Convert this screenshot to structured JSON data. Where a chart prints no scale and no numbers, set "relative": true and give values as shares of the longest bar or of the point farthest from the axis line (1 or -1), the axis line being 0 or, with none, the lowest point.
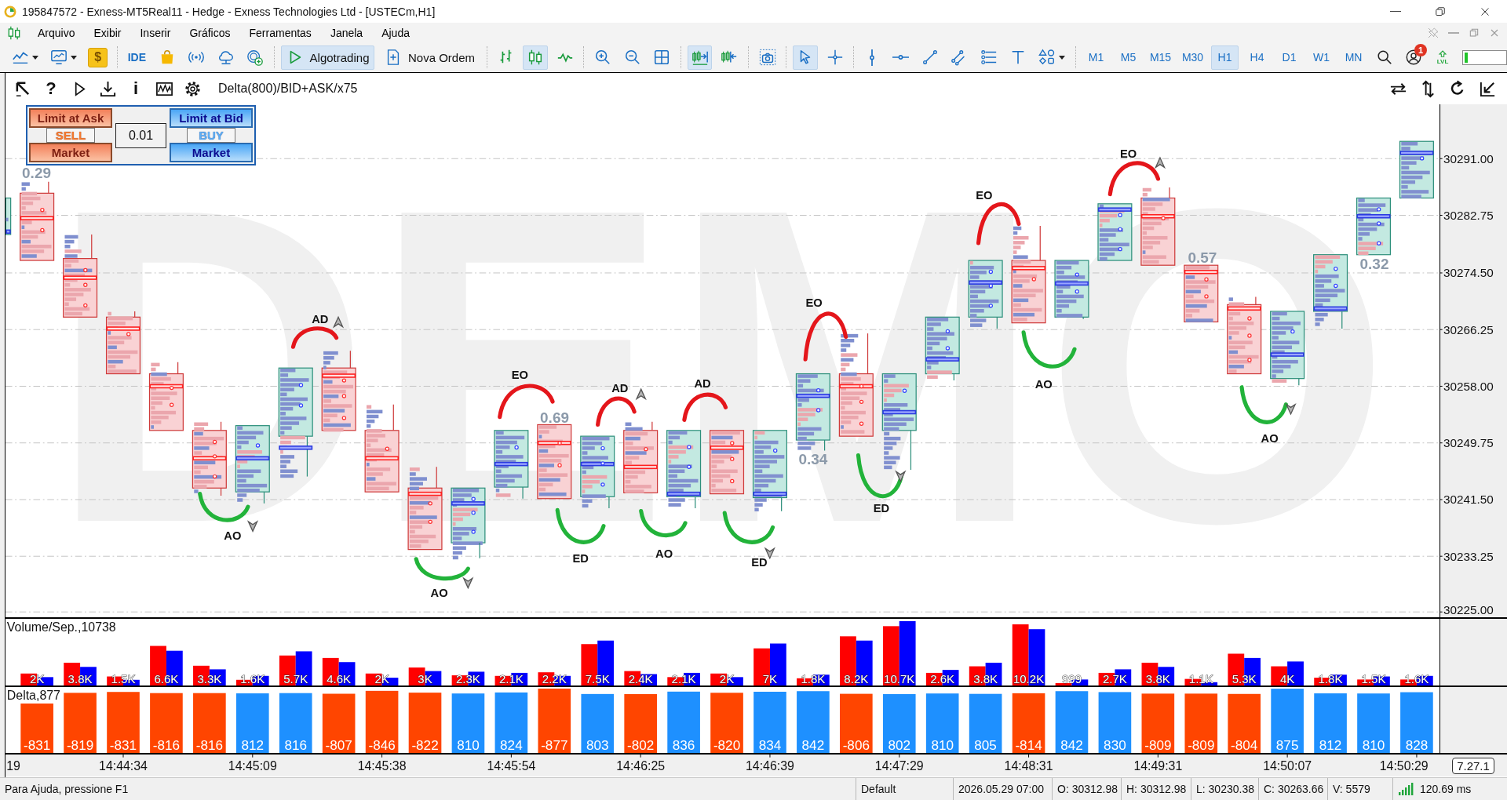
{
  "window": {
    "title": "195847572 - Exness-MT5Real11 - Hedge - Exness Technologies Ltd - [USTECm,H1]"
  },
  "menu": [
    "Arquivo",
    "Exibir",
    "Inserir",
    "Gráficos",
    "Ferramentas",
    "Janela",
    "Ajuda"
  ],
  "toolbar": {
    "market_glyph": "$",
    "ide": "IDE",
    "algotrading": {
      "label": "Algotrading",
      "on": true
    },
    "new_order": "Nova Ordem",
    "chart_types": [
      {
        "kind": "bars",
        "selected": false
      },
      {
        "kind": "candles",
        "selected": true
      },
      {
        "kind": "line",
        "selected": false
      }
    ],
    "scroll_tools": [
      {
        "kind": "autoscroll",
        "selected": true
      },
      {
        "kind": "shift",
        "selected": false
      }
    ],
    "pointer_tools": [
      {
        "kind": "cursor",
        "selected": true
      },
      {
        "kind": "crosshair",
        "selected": false
      }
    ],
    "timeframes": [
      {
        "label": "M1",
        "selected": false
      },
      {
        "label": "M5",
        "selected": false
      },
      {
        "label": "M15",
        "selected": false
      },
      {
        "label": "M30",
        "selected": false
      },
      {
        "label": "H1",
        "selected": true
      },
      {
        "label": "H4",
        "selected": false
      },
      {
        "label": "D1",
        "selected": false
      },
      {
        "label": "W1",
        "selected": false
      },
      {
        "label": "MN",
        "selected": false
      }
    ],
    "notifications": "1",
    "level_badge": "LVL",
    "quota": {
      "level": 0.07
    }
  },
  "chart": {
    "toolbar": {
      "help": "?",
      "info": "i",
      "indicator": "Delta(800)/BID+ASK/x75"
    },
    "order_panel": {
      "sell": {
        "limit": "Limit at Ask",
        "side": "SELL",
        "market": "Market"
      },
      "lot": "0.01",
      "buy": {
        "limit": "Limit at Bid",
        "side": "BUY",
        "market": "Market"
      }
    },
    "watermark": "DEMO",
    "price_axis": [
      "30291.00",
      "30282.75",
      "30274.50",
      "30266.25",
      "30258.00",
      "30249.75",
      "30241.50",
      "30233.25",
      "30225.00"
    ],
    "candles": [
      {
        "kind": "bull"
      },
      {
        "kind": "bear"
      },
      {
        "kind": "bear"
      },
      {
        "kind": "bear"
      },
      {
        "kind": "bear"
      },
      {
        "kind": "bear"
      },
      {
        "kind": "bull"
      },
      {
        "kind": "bull"
      },
      {
        "kind": "bear"
      },
      {
        "kind": "bear"
      },
      {
        "kind": "bear"
      },
      {
        "kind": "bull"
      },
      {
        "kind": "bull"
      },
      {
        "kind": "bear"
      },
      {
        "kind": "bull"
      },
      {
        "kind": "bear"
      },
      {
        "kind": "bull"
      },
      {
        "kind": "bear"
      },
      {
        "kind": "bull"
      },
      {
        "kind": "bull"
      },
      {
        "kind": "bear"
      },
      {
        "kind": "bull"
      },
      {
        "kind": "bull"
      },
      {
        "kind": "bull"
      },
      {
        "kind": "bear"
      },
      {
        "kind": "bull"
      },
      {
        "kind": "bull"
      },
      {
        "kind": "bear"
      },
      {
        "kind": "bear"
      },
      {
        "kind": "bear"
      },
      {
        "kind": "bull"
      },
      {
        "kind": "bull"
      },
      {
        "kind": "bull"
      },
      {
        "kind": "bull"
      }
    ],
    "ratios": [
      "0.29",
      "0.69",
      "0.34",
      "0.57",
      "0.32"
    ],
    "markers": [
      {
        "kind": "bottom",
        "label": "AO",
        "arrow": true
      },
      {
        "kind": "top",
        "label": "AD",
        "arrow": true
      },
      {
        "kind": "bottom",
        "label": "AO",
        "arrow": true
      },
      {
        "kind": "top",
        "label": "EO",
        "arrow": false
      },
      {
        "kind": "bottom",
        "label": "ED",
        "arrow": false
      },
      {
        "kind": "top",
        "label": "AD",
        "arrow": true
      },
      {
        "kind": "bottom",
        "label": "AO",
        "arrow": false
      },
      {
        "kind": "top",
        "label": "AD",
        "arrow": false
      },
      {
        "kind": "bottom",
        "label": "ED",
        "arrow": true
      },
      {
        "kind": "top",
        "label": "EO",
        "arrow": false
      },
      {
        "kind": "bottom",
        "label": "ED",
        "arrow": true
      },
      {
        "kind": "top",
        "label": "EO",
        "arrow": false
      },
      {
        "kind": "bottom",
        "label": "AO",
        "arrow": false
      },
      {
        "kind": "top",
        "label": "EO",
        "arrow": true
      },
      {
        "kind": "bottom",
        "label": "AO",
        "arrow": true
      }
    ],
    "volume": {
      "title": "Volume/Sep.,10738",
      "bar_labels": [
        "2K",
        "3.8K",
        "1.5K",
        "6.6K",
        "3.3K",
        "1.6K",
        "5.7K",
        "4.6K",
        "2K",
        "3K",
        "2.3K",
        "2.1K",
        "2.2K",
        "7.5K",
        "2.4K",
        "2.1K",
        "2K",
        "7K",
        "1.8K",
        "8.2K",
        "10.7K",
        "2.6K",
        "3.8K",
        "10.2K",
        "999",
        "2.7K",
        "3.8K",
        "1.1K",
        "5.3K",
        "4K",
        "1.8K",
        "1.5K",
        "1.6K"
      ],
      "chart_data": {
        "type": "bar",
        "relative": true,
        "categories": [
          null,
          null,
          null,
          null,
          null,
          null,
          null,
          null,
          null,
          null,
          null,
          null,
          null,
          null,
          null,
          null,
          null,
          null,
          null,
          null,
          null,
          null,
          null,
          null,
          null,
          null,
          null,
          null,
          null,
          null,
          null,
          null,
          null
        ],
        "series": [
          {
            "color": "#ff0000",
            "values": [
              0.186,
              0.354,
              0.14,
              0.615,
              0.307,
              0.088,
              0.466,
              0.428,
              0.186,
              0.279,
              0.158,
              0.149,
              0.205,
              0.643,
              0.224,
              0.13,
              0.186,
              0.577,
              0.112,
              0.764,
              0.922,
              0.196,
              0.298,
              0.95,
              0.037,
              0.196,
              0.354,
              0.102,
              0.494,
              0.298,
              0.121,
              0.093,
              0.093
            ]
          },
          {
            "color": "#0000ff",
            "values": [
              0.13,
              0.289,
              0.088,
              0.54,
              0.251,
              0.149,
              0.531,
              0.363,
              0.121,
              0.224,
              0.214,
              0.196,
              0.149,
              0.698,
              0.177,
              0.196,
              0.13,
              0.652,
              0.168,
              0.698,
              1.0,
              0.242,
              0.354,
              0.875,
              0.093,
              0.251,
              0.289,
              0.051,
              0.428,
              0.373,
              0.168,
              0.14,
              0.149
            ]
          }
        ]
      }
    },
    "delta": {
      "title": "Delta,877",
      "bar_labels": [
        "-831",
        "-819",
        "-831",
        "-816",
        "-816",
        "812",
        "816",
        "-807",
        "-846",
        "-822",
        "810",
        "824",
        "-877",
        "803",
        "-802",
        "836",
        "-820",
        "834",
        "842",
        "-806",
        "802",
        "810",
        "805",
        "-814",
        "842",
        "830",
        "-809",
        "-809",
        "-804",
        "875",
        "812",
        "810",
        "828"
      ],
      "chart_data": {
        "type": "bar",
        "relative": true,
        "stacked": true,
        "categories": [
          null,
          null,
          null,
          null,
          null,
          null,
          null,
          null,
          null,
          null,
          null,
          null,
          null,
          null,
          null,
          null,
          null,
          null,
          null,
          null,
          null,
          null,
          null,
          null,
          null,
          null,
          null,
          null,
          null,
          null,
          null,
          null,
          null
        ],
        "series": [
          {
            "color": "#ff4500",
            "values": [
              0.768,
              0.934,
              0.948,
              0.93,
              0.93,
              null,
              null,
              0.92,
              0.965,
              0.937,
              null,
              null,
              1.0,
              null,
              0.914,
              null,
              0.935,
              null,
              null,
              0.919,
              null,
              null,
              null,
              0.928,
              null,
              null,
              0.922,
              0.922,
              0.917,
              null,
              null,
              null,
              null
            ]
          },
          {
            "color": "#1e90ff",
            "values": [
              null,
              null,
              null,
              null,
              null,
              0.926,
              0.93,
              null,
              null,
              null,
              0.924,
              0.94,
              null,
              0.916,
              null,
              0.953,
              null,
              0.951,
              0.96,
              null,
              0.914,
              0.924,
              0.918,
              null,
              0.96,
              0.946,
              null,
              null,
              null,
              0.998,
              0.926,
              0.924,
              0.944
            ]
          }
        ]
      }
    },
    "time_axis": [
      "19",
      "14:44:34",
      "14:45:09",
      "14:45:38",
      "14:45:54",
      "14:46:25",
      "14:46:39",
      "14:47:29",
      "14:48:31",
      "14:49:31",
      "14:50:07",
      "14:50:29"
    ],
    "version": "7.27.1"
  },
  "status_bar": {
    "help": "Para Ajuda, pressione F1",
    "profile": "Default",
    "date": "2026.05.29 07:00",
    "open": "O: 30312.98",
    "high": "H: 30312.98",
    "low": "L: 30230.38",
    "close": "C: 30263.66",
    "volume": "V: 5579",
    "ping": "120.69 ms"
  }
}
